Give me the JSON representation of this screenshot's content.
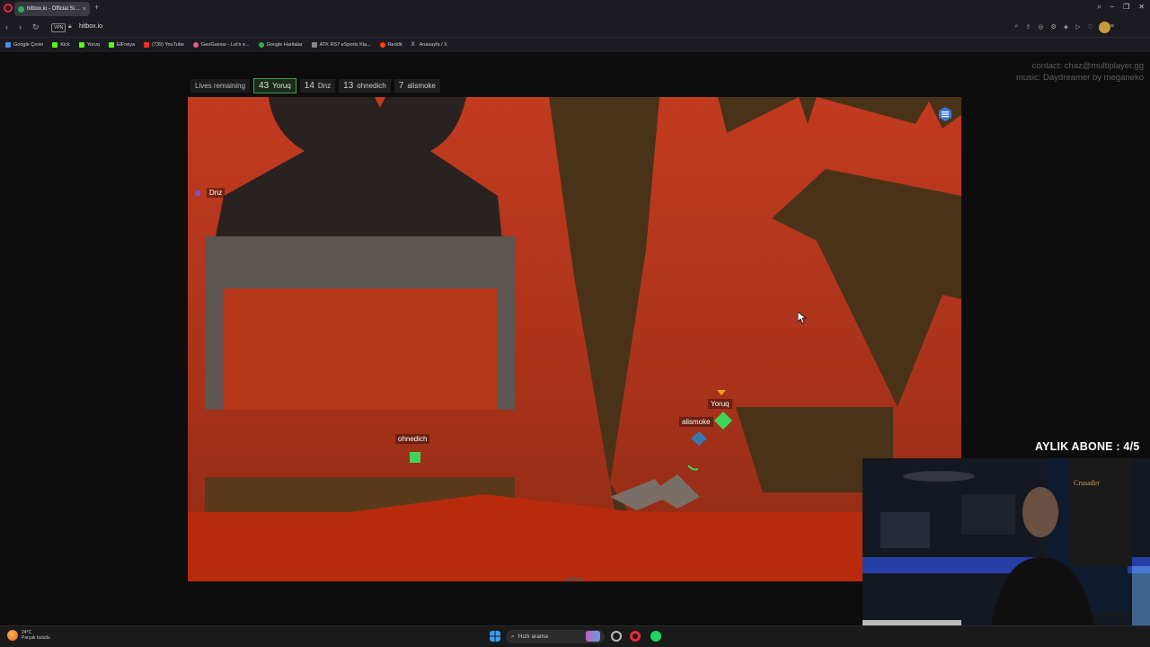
{
  "browser": {
    "tab_title": "hitbox.io - Official Si…",
    "url": "hitbox.io",
    "vpn_label": "VPN",
    "bookmarks": [
      {
        "label": "Google Çeviri",
        "color": "#4a8af4"
      },
      {
        "label": "Kick",
        "color": "#53fc18"
      },
      {
        "label": "Yoruq",
        "color": "#53fc18"
      },
      {
        "label": "ElFreiya",
        "color": "#53fc18"
      },
      {
        "label": "(739) YouTube",
        "color": "#ff2a2a"
      },
      {
        "label": "GeoGuessr - Let's e...",
        "color": "#e85a8a"
      },
      {
        "label": "Google Haritalar",
        "color": "#34a853"
      },
      {
        "label": "ATK RS7 eSports Kla...",
        "color": "#888888"
      },
      {
        "label": "Reddit",
        "color": "#ff4500"
      },
      {
        "label": "Anasayfa / X",
        "color": "#dddddd"
      }
    ]
  },
  "credits": {
    "contact": "contact: chaz@multiplayer.gg",
    "music": "music: Daydreamer by meganeko"
  },
  "lives": {
    "label": "Lives remaining",
    "players": [
      {
        "count": "43",
        "name": "Yoruq"
      },
      {
        "count": "14",
        "name": "Dnz"
      },
      {
        "count": "13",
        "name": "ohnedich"
      },
      {
        "count": "7",
        "name": "alismoke"
      }
    ]
  },
  "game": {
    "players": {
      "dnz": "Dnz",
      "ohnedich": "ohnedich",
      "yoruq": "Yoruq",
      "alismoke": "alismoke"
    },
    "colors": {
      "sky": "#c23b20",
      "dark": "#2a2220",
      "brown": "#4a3218",
      "gray_frame": "#5c5550",
      "floor": "#b82a0c",
      "player_green": "#3fd45a",
      "player_blue": "#3a78b0"
    }
  },
  "stream": {
    "banner": "AYLIK ABONE : 4/5"
  },
  "taskbar": {
    "temp": "24°C",
    "weather": "Parçalı bulutlu",
    "search_placeholder": "Hızlı arama"
  }
}
